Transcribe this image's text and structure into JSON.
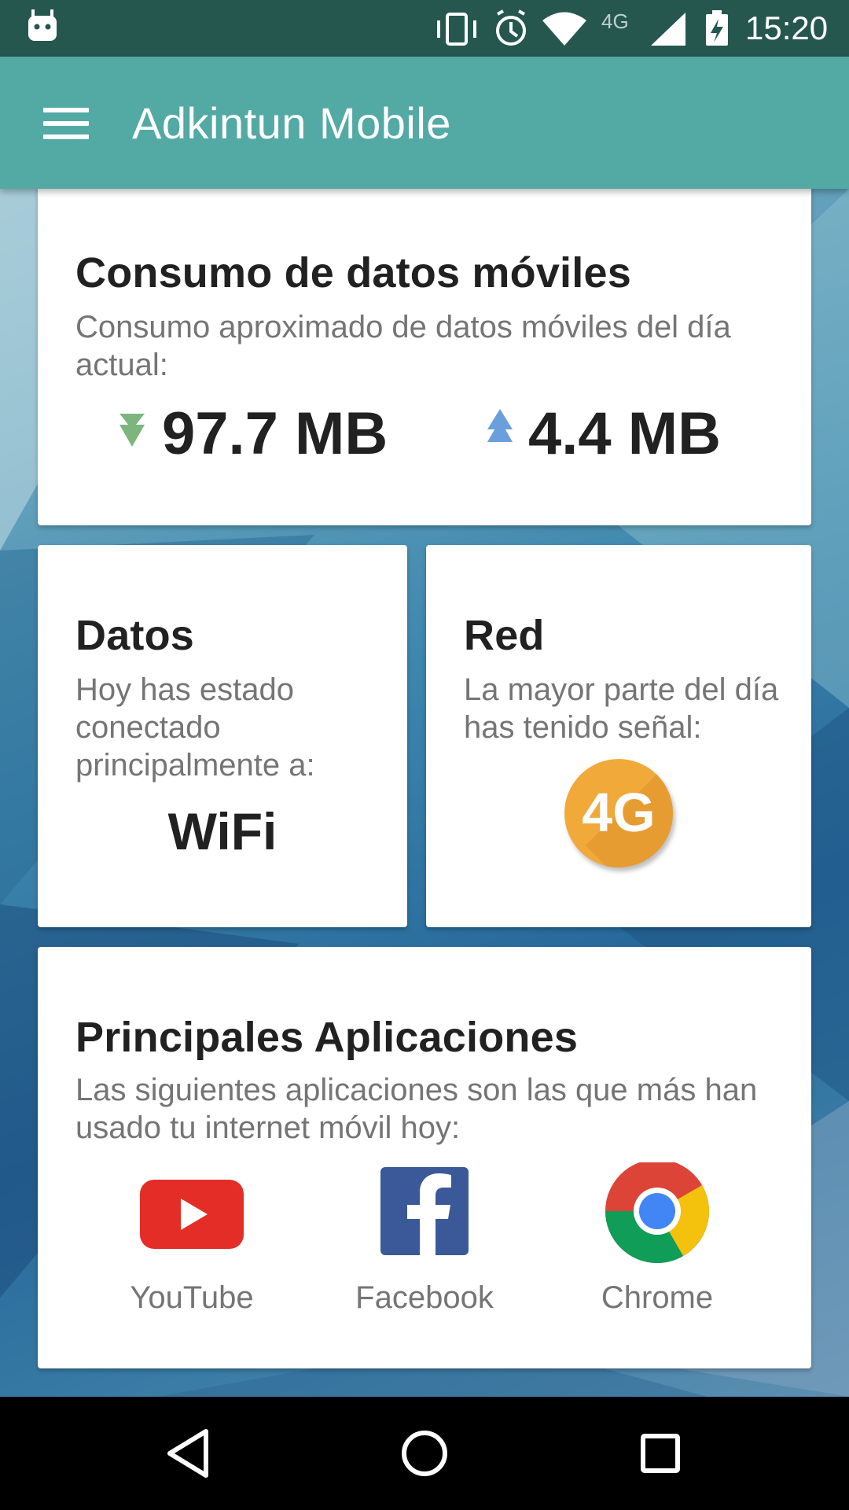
{
  "status_bar": {
    "time": "15:20",
    "network_label": "4G",
    "icons": [
      "android-notification-icon",
      "vibrate-icon",
      "alarm-icon",
      "wifi-icon",
      "cell-signal-icon",
      "battery-charging-icon"
    ]
  },
  "app_bar": {
    "title": "Adkintun Mobile",
    "menu_icon": "hamburger-menu-icon",
    "color": "#53a9a4"
  },
  "consumption_card": {
    "title": "Consumo de datos móviles",
    "subtitle": "Consumo aproximado de datos móviles del día actual:",
    "download": "97.7 MB",
    "upload": "4.4 MB",
    "download_color": "#7cb67e",
    "upload_color": "#6b9fdc"
  },
  "data_card": {
    "title": "Datos",
    "subtitle": "Hoy has estado conectado principalmente a:",
    "value": "WiFi"
  },
  "network_card": {
    "title": "Red",
    "subtitle": "La mayor parte del día has tenido señal:",
    "badge": "4G",
    "badge_color": "#f1a93a"
  },
  "apps_card": {
    "title": "Principales Aplicaciones",
    "subtitle": "Las siguientes aplicaciones son las que más han usado tu internet móvil hoy:",
    "apps": [
      {
        "name": "YouTube",
        "icon": "youtube-icon"
      },
      {
        "name": "Facebook",
        "icon": "facebook-icon"
      },
      {
        "name": "Chrome",
        "icon": "chrome-icon"
      }
    ]
  },
  "nav_bar": {
    "buttons": [
      "back-icon",
      "home-icon",
      "recents-icon"
    ]
  }
}
